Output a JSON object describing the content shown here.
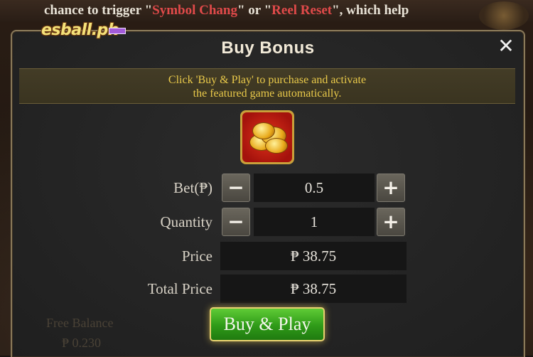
{
  "ticker": {
    "prefix": "chance to trigger \"",
    "symbol_chang": "Symbol Chang",
    "middle": "\" or \"",
    "reel_reset": "Reel Reset",
    "suffix": "\", which help"
  },
  "logo": {
    "text": "esball.ph"
  },
  "dialog": {
    "title": "Buy Bonus",
    "close_glyph": "✕",
    "notice_line1": "Click 'Buy & Play' to purchase and activate",
    "notice_line2": "the featured game automatically."
  },
  "form": {
    "bet": {
      "label": "Bet(₱)",
      "value": "0.5",
      "minus": "−",
      "plus": "+"
    },
    "quantity": {
      "label": "Quantity",
      "value": "1",
      "minus": "−",
      "plus": "+"
    },
    "price": {
      "label": "Price",
      "value": "₱ 38.75"
    },
    "total_price": {
      "label": "Total Price",
      "value": "₱ 38.75"
    }
  },
  "buy_button": {
    "label": "Buy & Play"
  },
  "background": {
    "ghost_left": "Free Balance",
    "ghost_value": "₱ 0.230"
  },
  "colors": {
    "notice_text": "#e9c94a",
    "ticker_highlight": "#e04a4a",
    "buy_button_green": "#2f9a18",
    "dialog_border": "#8a7a5a"
  },
  "icons": [
    "close-icon",
    "minus-icon",
    "plus-icon",
    "gold-coins-bonus-icon"
  ]
}
